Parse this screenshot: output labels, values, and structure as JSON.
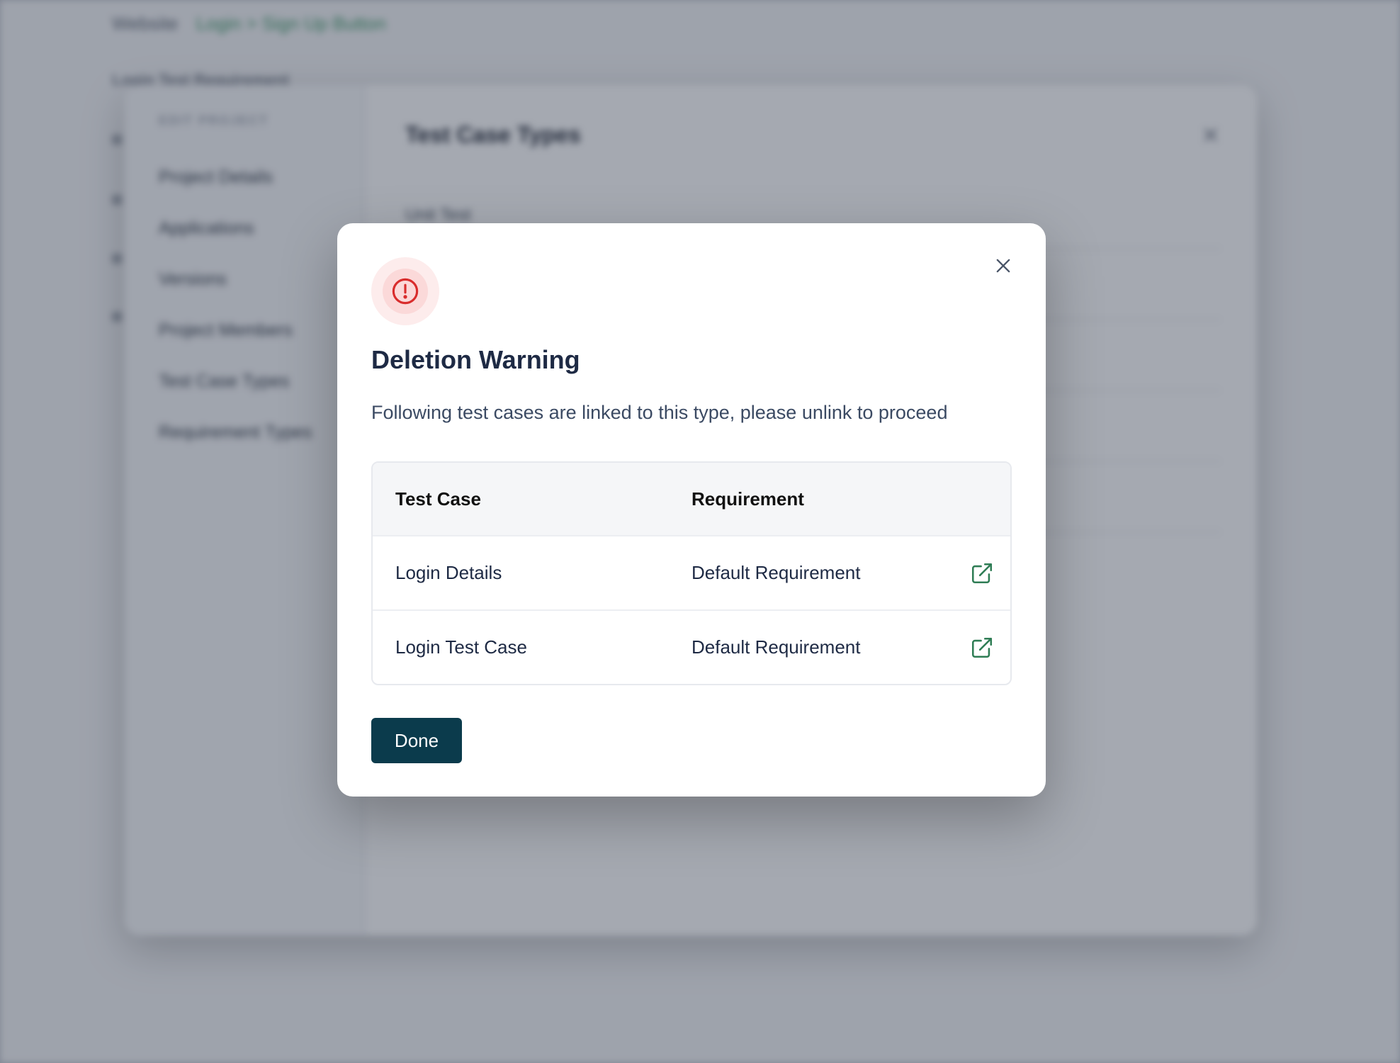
{
  "background": {
    "breadcrumb": {
      "root": "Website",
      "current": "Login > Sign Up Button"
    },
    "subtitle": "Login Test Requirement",
    "panel": {
      "sidebar_heading": "EDIT PROJECT",
      "sidebar_items": [
        "Project Details",
        "Applications",
        "Versions",
        "Project Members",
        "Test Case Types",
        "Requirement Types"
      ],
      "title": "Test Case Types",
      "first_row": "Unit Test"
    }
  },
  "modal": {
    "title": "Deletion Warning",
    "description": "Following test cases are linked to this type, please unlink to proceed",
    "table": {
      "headers": [
        "Test Case",
        "Requirement"
      ],
      "rows": [
        {
          "test_case": "Login Details",
          "requirement": "Default Requirement"
        },
        {
          "test_case": "Login Test Case",
          "requirement": "Default Requirement"
        }
      ]
    },
    "done_label": "Done",
    "icons": {
      "warning": "alert-circle-icon",
      "close": "close-icon",
      "open": "external-link-icon"
    },
    "colors": {
      "accent": "#0b3b4c",
      "warning": "#d92d2d",
      "link_icon": "#2f7d55"
    }
  }
}
